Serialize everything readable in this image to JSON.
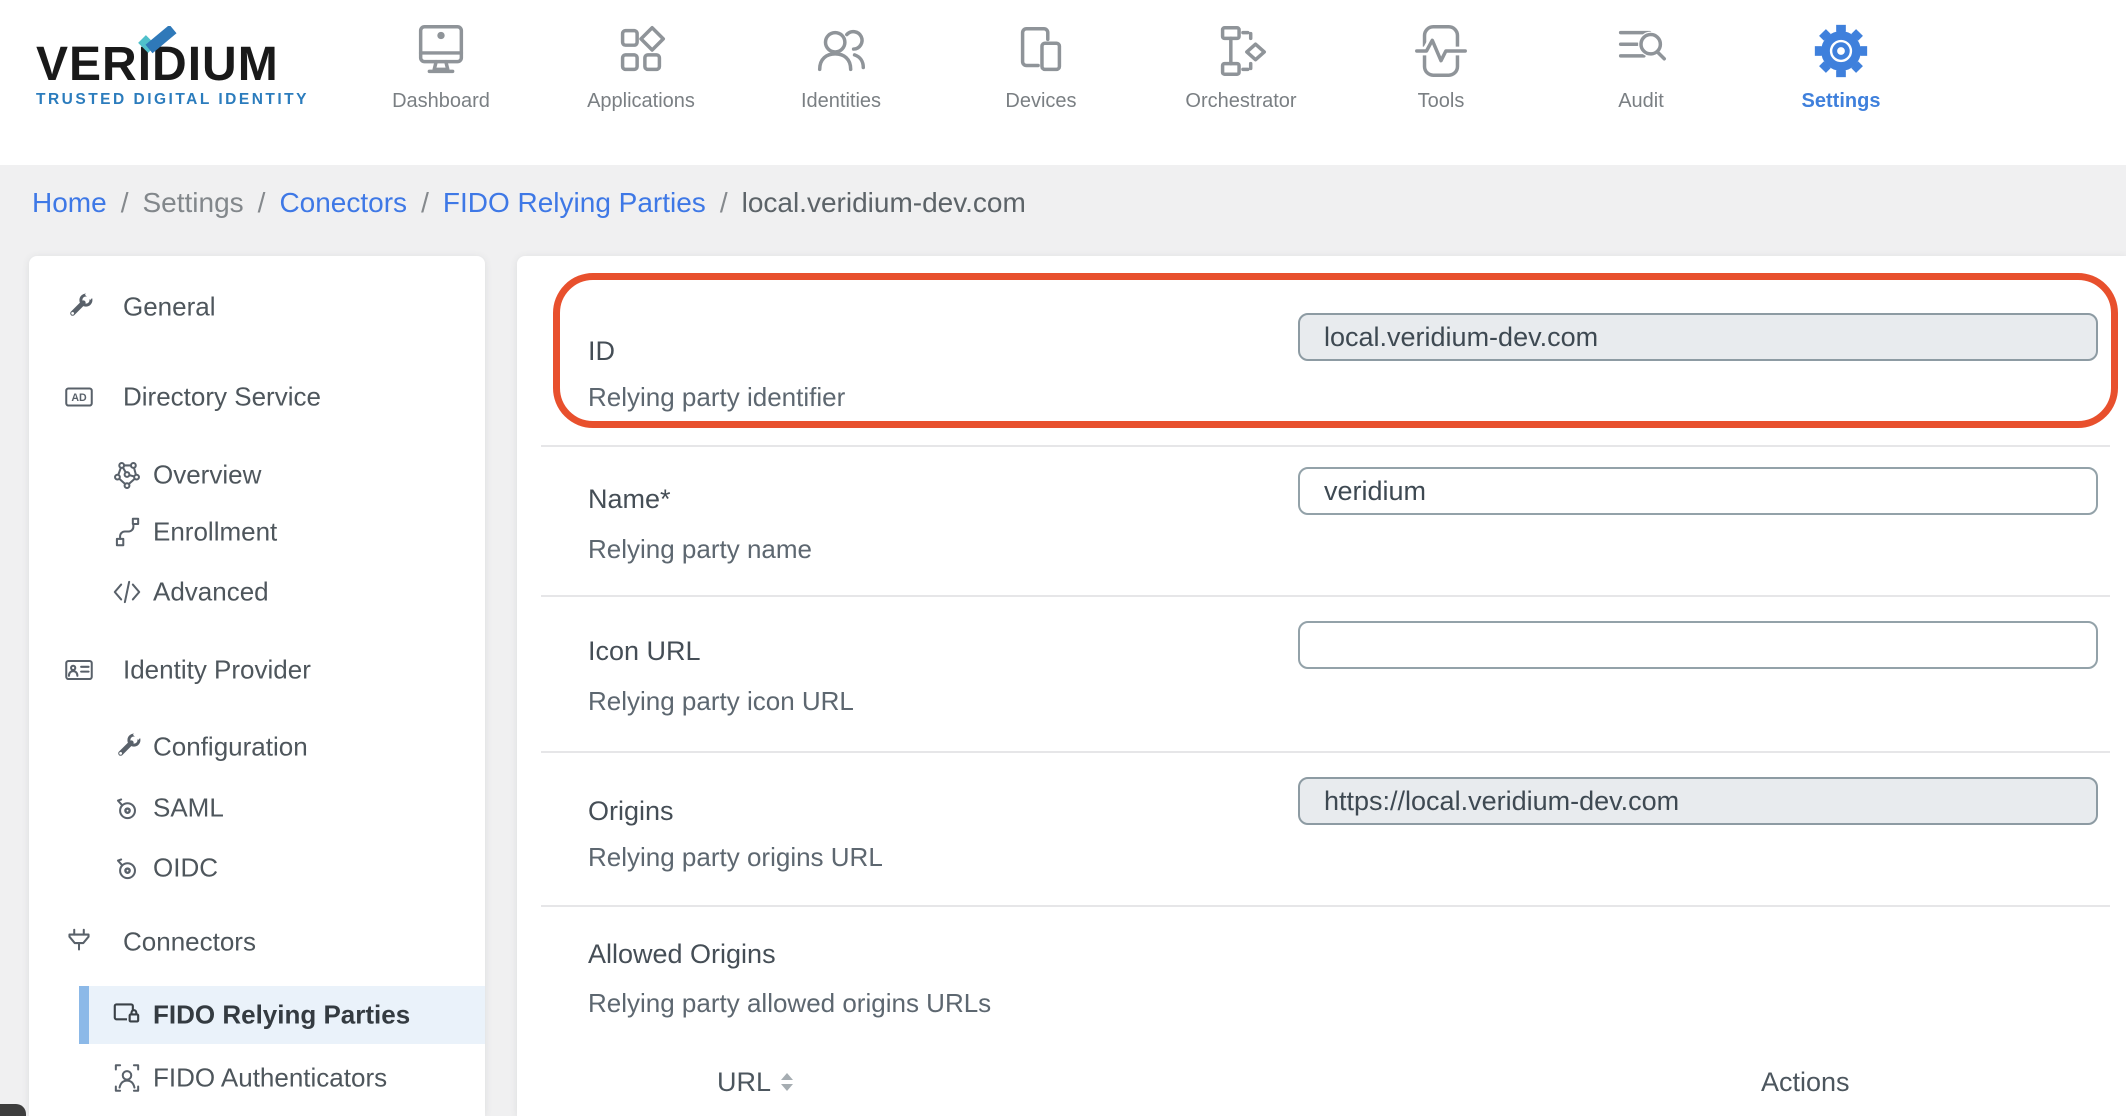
{
  "brand": {
    "name": "VERIDIUM",
    "tagline": "TRUSTED DIGITAL IDENTITY"
  },
  "nav": {
    "items": [
      {
        "label": "Dashboard",
        "active": false
      },
      {
        "label": "Applications",
        "active": false
      },
      {
        "label": "Identities",
        "active": false
      },
      {
        "label": "Devices",
        "active": false
      },
      {
        "label": "Orchestrator",
        "active": false
      },
      {
        "label": "Tools",
        "active": false
      },
      {
        "label": "Audit",
        "active": false
      },
      {
        "label": "Settings",
        "active": true
      }
    ]
  },
  "breadcrumb": {
    "separator": "/",
    "items": [
      {
        "label": "Home",
        "type": "link"
      },
      {
        "label": "Settings",
        "type": "text"
      },
      {
        "label": "Conectors",
        "type": "link"
      },
      {
        "label": "FIDO Relying Parties",
        "type": "link"
      },
      {
        "label": "local.veridium-dev.com",
        "type": "current"
      }
    ]
  },
  "sidebar": {
    "items": [
      {
        "label": "General",
        "level": "section"
      },
      {
        "label": "Directory Service",
        "level": "section",
        "badge": "AD"
      },
      {
        "label": "Overview",
        "level": "child"
      },
      {
        "label": "Enrollment",
        "level": "child"
      },
      {
        "label": "Advanced",
        "level": "child"
      },
      {
        "label": "Identity Provider",
        "level": "section"
      },
      {
        "label": "Configuration",
        "level": "child"
      },
      {
        "label": "SAML",
        "level": "child"
      },
      {
        "label": "OIDC",
        "level": "child"
      },
      {
        "label": "Connectors",
        "level": "section"
      },
      {
        "label": "FIDO Relying Parties",
        "level": "child",
        "active": true
      },
      {
        "label": "FIDO Authenticators",
        "level": "child"
      }
    ]
  },
  "form": {
    "rows": [
      {
        "label": "ID",
        "sublabel": "Relying party identifier",
        "value": "local.veridium-dev.com",
        "disabled": true,
        "highlighted": true
      },
      {
        "label": "Name*",
        "sublabel": "Relying party name",
        "value": "veridium",
        "disabled": false
      },
      {
        "label": "Icon URL",
        "sublabel": "Relying party icon URL",
        "value": "",
        "disabled": false
      },
      {
        "label": "Origins",
        "sublabel": "Relying party origins URL",
        "value": "https://local.veridium-dev.com",
        "disabled": true
      },
      {
        "label": "Allowed Origins",
        "sublabel": "Relying party allowed origins URLs"
      }
    ],
    "table": {
      "columns": [
        {
          "label": "URL",
          "sortable": true
        },
        {
          "label": "Actions",
          "sortable": false
        }
      ]
    }
  },
  "colors": {
    "accent_blue": "#3f80dc",
    "breadcrumb_link": "#3e78e6",
    "highlight_red": "#e8502d",
    "active_item_bg": "#eaf2fa",
    "active_item_bar": "#8cb9e8",
    "disabled_input_bg": "#e8ebee"
  }
}
